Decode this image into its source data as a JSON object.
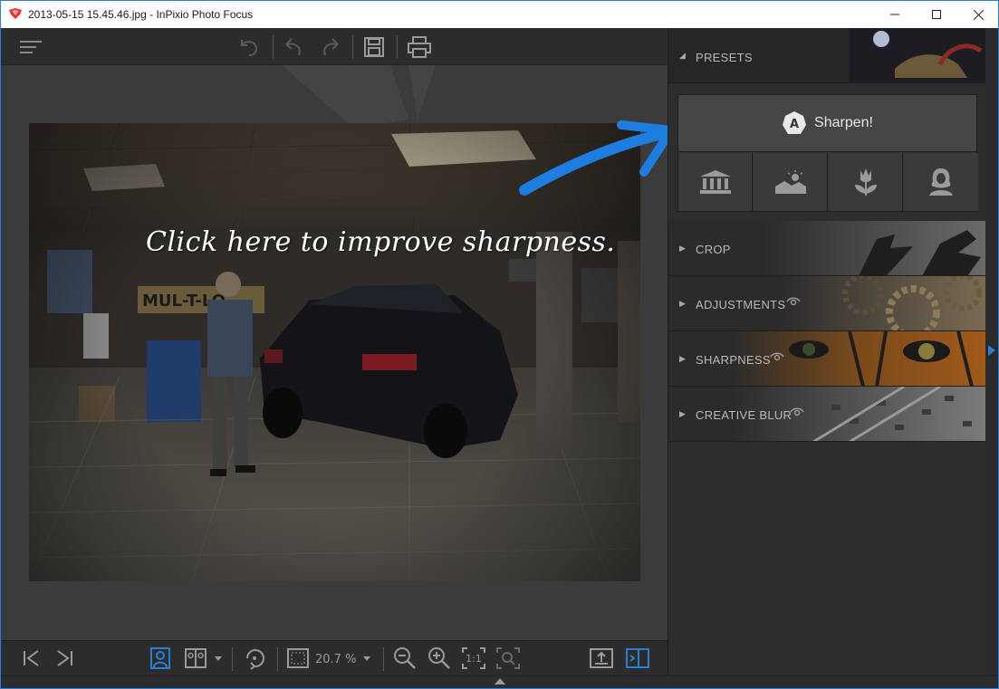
{
  "window": {
    "title": "2013-05-15 15.45.46.jpg - InPixio Photo Focus"
  },
  "toolbar": {
    "menu_icon": "hamburger-menu-icon",
    "undo_all_icon": "undo-all-icon",
    "undo_icon": "undo-icon",
    "redo_icon": "redo-icon",
    "save_icon": "save-icon",
    "print_icon": "print-icon"
  },
  "canvas": {
    "callout_text": "Click here to improve sharpness."
  },
  "bottombar": {
    "zoom_value": "20.7 %"
  },
  "panel": {
    "presets_label": "PRESETS",
    "sharpen_badge": "A",
    "sharpen_label": "Sharpen!",
    "preset_tiles": [
      {
        "icon": "architecture-icon"
      },
      {
        "icon": "landscape-icon"
      },
      {
        "icon": "flower-icon"
      },
      {
        "icon": "portrait-icon"
      }
    ],
    "sections": [
      {
        "label": "CROP",
        "eye": false
      },
      {
        "label": "ADJUSTMENTS",
        "eye": true
      },
      {
        "label": "SHARPNESS",
        "eye": true
      },
      {
        "label": "CREATIVE BLUR",
        "eye": true
      }
    ]
  },
  "colors": {
    "accent": "#2a7fd4",
    "arrow_blue": "#1e7ee0"
  }
}
